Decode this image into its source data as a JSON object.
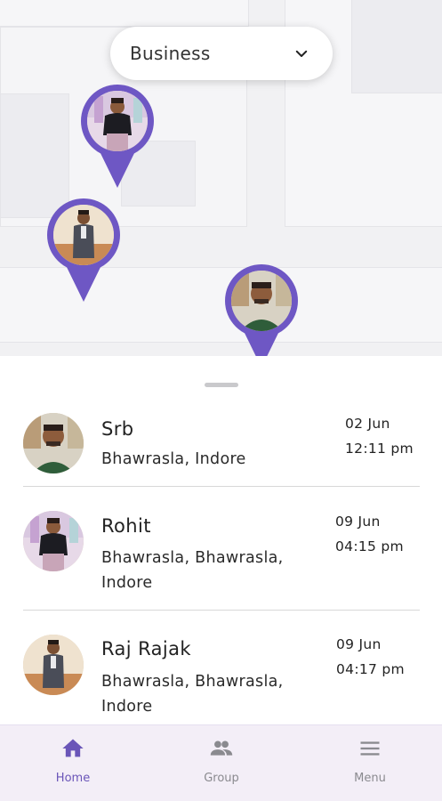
{
  "map": {
    "category_select": {
      "value": "Business"
    },
    "pins": [
      {
        "person": "Rohit"
      },
      {
        "person": "Raj Rajak"
      },
      {
        "person": "Srb"
      }
    ]
  },
  "contacts": [
    {
      "name": "Srb",
      "address": "Bhawrasla, Indore",
      "date": "02 Jun",
      "time": "12:11 pm"
    },
    {
      "name": "Rohit",
      "address": "Bhawrasla, Bhawrasla, Indore",
      "date": "09 Jun",
      "time": "04:15 pm"
    },
    {
      "name": "Raj Rajak",
      "address": "Bhawrasla, Bhawrasla, Indore",
      "date": "09 Jun",
      "time": "04:17 pm"
    }
  ],
  "nav": {
    "items": [
      {
        "label": "Home",
        "icon": "home-icon",
        "active": true
      },
      {
        "label": "Group",
        "icon": "group-icon",
        "active": false
      },
      {
        "label": "Menu",
        "icon": "menu-icon",
        "active": false
      }
    ]
  },
  "colors": {
    "accent": "#6a55b8",
    "pin": "#6e57c4",
    "nav_background": "#f3eef7"
  }
}
